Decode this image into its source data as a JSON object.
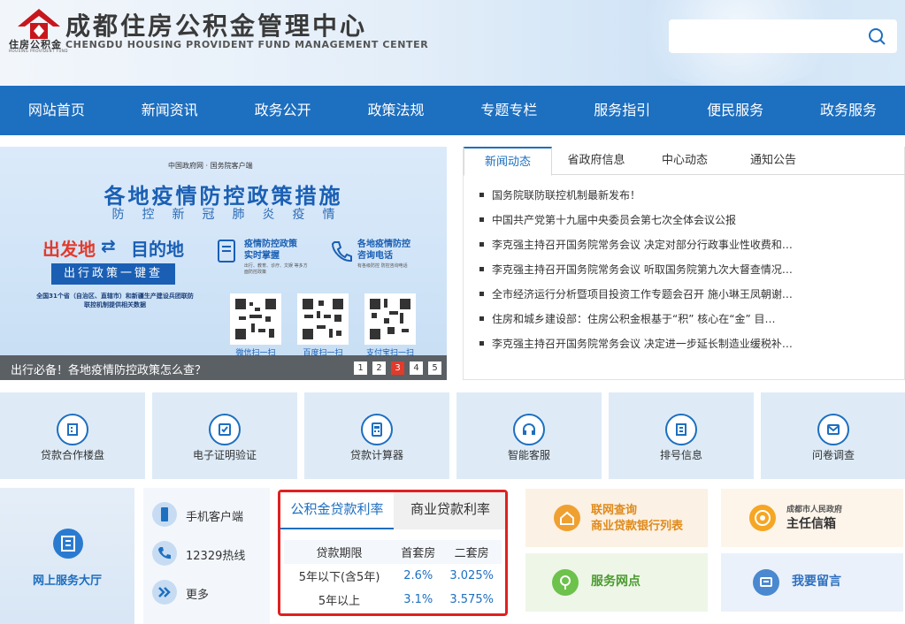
{
  "header": {
    "logo_text": "住房公积金",
    "logo_text_en": "HOUSING PROVIDENT FUND",
    "title": "成都住房公积金管理中心",
    "title_en": "CHENGDU HOUSING PROVIDENT FUND MANAGEMENT CENTER",
    "search_placeholder": "",
    "search_icon": "search-icon"
  },
  "nav": [
    "网站首页",
    "新闻资讯",
    "政务公开",
    "政策法规",
    "专题专栏",
    "服务指引",
    "便民服务",
    "政务服务"
  ],
  "banner": {
    "top_logos": "中国政府网 · 国务院客户端",
    "title": "各地疫情防控政策措施",
    "subtitle": "防控新冠肺炎疫情",
    "from": "出发地",
    "to": "目的地",
    "button": "出行政策一键查",
    "note": "全国31个省（自治区、直辖市）和新疆生产建设兵团联防联控机制提供相关数据",
    "info1_title": "疫情防控政策 实时掌握",
    "info1_sub": "出行、教育、诊疗、文娱 等多方面防控政策",
    "info2_title": "各地疫情防控 咨询电话",
    "info2_sub": "有各级防控 防控咨询电话",
    "qr_labels": [
      "微信扫一扫",
      "百度扫一扫",
      "支付宝扫一扫"
    ],
    "caption": "出行必备！各地疫情防控政策怎么查？",
    "pages": [
      "1",
      "2",
      "3",
      "4",
      "5"
    ],
    "active_page": 3
  },
  "news": {
    "tabs": [
      "新闻动态",
      "省政府信息",
      "中心动态",
      "通知公告"
    ],
    "items": [
      "国务院联防联控机制最新发布！",
      "中国共产党第十九届中央委员会第七次全体会议公报",
      "李克强主持召开国务院常务会议 决定对部分行政事业性收费和…",
      "李克强主持召开国务院常务会议 听取国务院第九次大督查情况…",
      "全市经济运行分析暨项目投资工作专题会召开 施小琳王凤朝谢…",
      "住房和城乡建设部：住房公积金根基于“积” 核心在“金” 目…",
      "李克强主持召开国务院常务会议 决定进一步延长制造业缓税补…"
    ]
  },
  "tiles": [
    {
      "label": "贷款合作楼盘",
      "icon": "building-icon"
    },
    {
      "label": "电子证明验证",
      "icon": "certificate-icon"
    },
    {
      "label": "贷款计算器",
      "icon": "calculator-icon"
    },
    {
      "label": "智能客服",
      "icon": "headset-icon"
    },
    {
      "label": "排号信息",
      "icon": "queue-ticket-icon"
    },
    {
      "label": "问卷调查",
      "icon": "survey-icon"
    }
  ],
  "hall": {
    "label": "网上服务大厅"
  },
  "quick_links": [
    {
      "label": "手机客户端",
      "icon": "phone-icon"
    },
    {
      "label": "12329热线",
      "icon": "hotline-icon"
    },
    {
      "label": "更多",
      "icon": "more-icon"
    }
  ],
  "rates": {
    "tabs": [
      "公积金贷款利率",
      "商业贷款利率"
    ],
    "headers": [
      "贷款期限",
      "首套房",
      "二套房"
    ],
    "rows": [
      [
        "5年以下(含5年)",
        "2.6%",
        "3.025%"
      ],
      [
        "5年以上",
        "3.1%",
        "3.575%"
      ]
    ]
  },
  "cards": {
    "lianwang_l1": "联网查询",
    "lianwang_l2": "商业贷款银行列表",
    "mayor_small": "成都市人民政府",
    "mayor_big": "主任信箱",
    "outlets": "服务网点",
    "message": "我要留言"
  },
  "colors": {
    "primary": "#1d6fc0",
    "accent_red": "#e23a2b",
    "highlight_border": "#e02020",
    "orange": "#f0a030",
    "green": "#6cc24a"
  }
}
